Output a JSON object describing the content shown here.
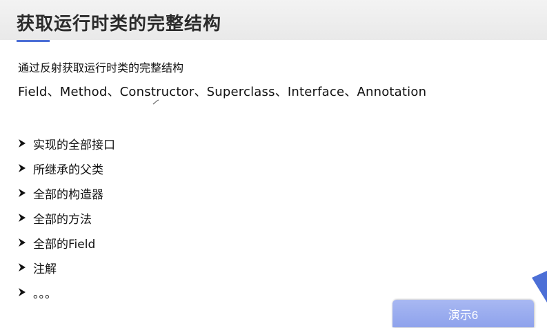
{
  "slide": {
    "title": "获取运行时类的完整结构",
    "subtitle": "通过反射获取运行时类的完整结构",
    "members_line": "Field、Method、Constructor、Superclass、Interface、Annotation",
    "bullets": [
      "实现的全部接口",
      "所继承的父类",
      "全部的构造器",
      "全部的方法",
      "全部的Field",
      "注解",
      "。。。"
    ],
    "bullet_icon": "arrowhead-bullet-icon",
    "accent_color": "#4c6fd6"
  },
  "demo_button": {
    "label": "演示6",
    "color": "#8ea2ec"
  }
}
